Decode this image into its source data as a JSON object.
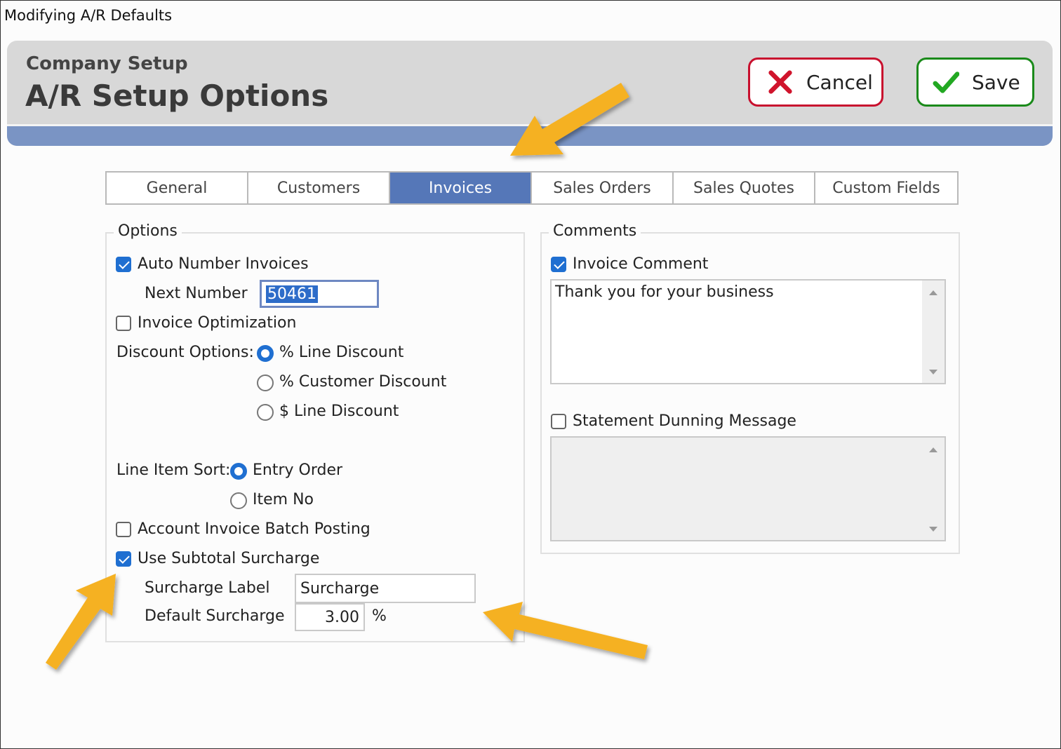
{
  "window": {
    "title": "Modifying A/R Defaults"
  },
  "header": {
    "subtitle": "Company Setup",
    "title": "A/R Setup Options",
    "cancel_label": "Cancel",
    "save_label": "Save"
  },
  "tabs": [
    {
      "label": "General",
      "active": false
    },
    {
      "label": "Customers",
      "active": false
    },
    {
      "label": "Invoices",
      "active": true
    },
    {
      "label": "Sales Orders",
      "active": false
    },
    {
      "label": "Sales Quotes",
      "active": false
    },
    {
      "label": "Custom Fields",
      "active": false
    }
  ],
  "options": {
    "group_label": "Options",
    "auto_number": {
      "label": "Auto Number Invoices",
      "checked": true
    },
    "next_number": {
      "label": "Next Number",
      "value": "50461"
    },
    "invoice_optimization": {
      "label": "Invoice Optimization",
      "checked": false
    },
    "discount": {
      "label": "Discount Options:",
      "choices": [
        {
          "label": "% Line Discount",
          "selected": true
        },
        {
          "label": "% Customer Discount",
          "selected": false
        },
        {
          "label": "$ Line Discount",
          "selected": false
        }
      ]
    },
    "sort": {
      "label": "Line Item Sort:",
      "choices": [
        {
          "label": "Entry Order",
          "selected": true
        },
        {
          "label": "Item No",
          "selected": false
        }
      ]
    },
    "batch_posting": {
      "label": "Account Invoice Batch Posting",
      "checked": false
    },
    "subtotal_surcharge": {
      "label": "Use Subtotal Surcharge",
      "checked": true
    },
    "surcharge_label": {
      "label": "Surcharge Label",
      "value": "Surcharge"
    },
    "default_surcharge": {
      "label": "Default Surcharge",
      "value": "3.00",
      "unit": "%"
    }
  },
  "comments": {
    "group_label": "Comments",
    "invoice_comment": {
      "label": "Invoice Comment",
      "checked": true,
      "value": "Thank you for your business"
    },
    "dunning": {
      "label": "Statement Dunning Message",
      "checked": false,
      "value": ""
    }
  },
  "colors": {
    "accent": "#5577b8",
    "cancel_border": "#c8102e",
    "save_border": "#1a8a1a",
    "annotation_arrow": "#f5b120"
  }
}
